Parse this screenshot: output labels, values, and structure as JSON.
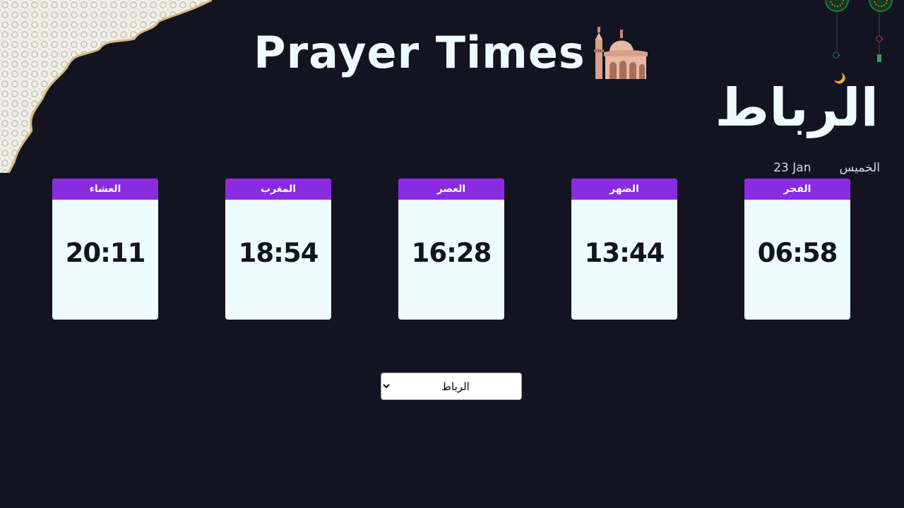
{
  "header": {
    "title": "Prayer Times",
    "icon": "mosque-icon"
  },
  "location": {
    "city": "الرباط",
    "day": "الخميس",
    "date": "23 Jan"
  },
  "prayers": [
    {
      "name": "الفجر",
      "time": "06:58"
    },
    {
      "name": "الضهر",
      "time": "13:44"
    },
    {
      "name": "العصر",
      "time": "16:28"
    },
    {
      "name": "المغرب",
      "time": "18:54"
    },
    {
      "name": "العشاء",
      "time": "20:11"
    }
  ],
  "city_select": {
    "selected": "الرباط"
  },
  "colors": {
    "background": "#131321",
    "accent": "#8a2be2",
    "card": "#eefcff"
  }
}
